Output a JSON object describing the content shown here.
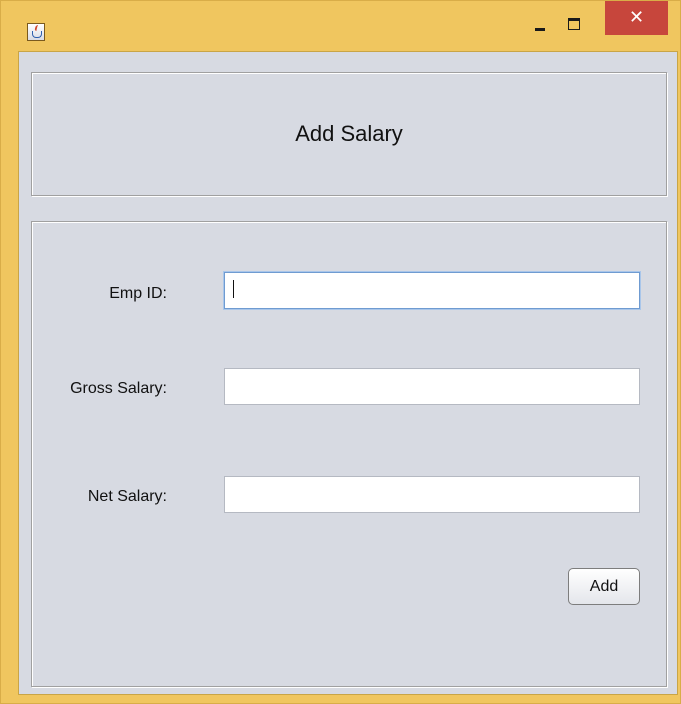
{
  "window": {
    "title": "",
    "icons": {
      "app": "java-icon",
      "minimize": "minimize-icon",
      "maximize": "maximize-icon",
      "close": "close-icon"
    },
    "close_glyph": "✕",
    "colors": {
      "frame": "#f0c65f",
      "close_button": "#c7463c",
      "client_background": "#d7dae2"
    }
  },
  "header": {
    "title": "Add Salary"
  },
  "form": {
    "emp_id_label": "Emp ID:",
    "emp_id_value": "",
    "gross_salary_label": "Gross Salary:",
    "gross_salary_value": "",
    "net_salary_label": "Net Salary:",
    "net_salary_value": "",
    "add_button_label": "Add"
  }
}
